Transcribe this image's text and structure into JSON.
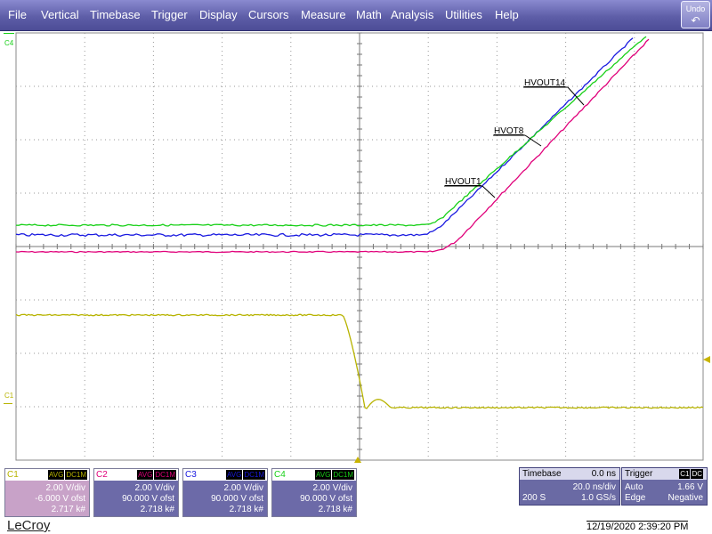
{
  "menu": {
    "items": [
      "File",
      "Vertical",
      "Timebase",
      "Trigger",
      "Display",
      "Cursors",
      "Measure",
      "Math",
      "Analysis",
      "Utilities",
      "Help"
    ],
    "undo_label": "Undo",
    "undo_icon": "undo-arrow-icon"
  },
  "markers": {
    "c4_marker": "C4",
    "c1_marker": "C1"
  },
  "trace_labels": {
    "hvout14": "HVOUT14",
    "hvot8": "HVOT8",
    "hvout1": "HVOUT1"
  },
  "channels": [
    {
      "name": "C1",
      "mode": "AVG",
      "coupling": "DC1M",
      "vdiv": "2.00 V/div",
      "offset": "-6.000 V ofst",
      "count": "2.717 k#",
      "color": "#b7b300",
      "bg": "#c8a2c8"
    },
    {
      "name": "C2",
      "mode": "AVG",
      "coupling": "DC1M",
      "vdiv": "2.00 V/div",
      "offset": "90.000 V ofst",
      "count": "2.718 k#",
      "color": "#e0007a",
      "bg": "#6c6aa8"
    },
    {
      "name": "C3",
      "mode": "AVG",
      "coupling": "DC1M",
      "vdiv": "2.00 V/div",
      "offset": "90.000 V ofst",
      "count": "2.718 k#",
      "color": "#1a1ae0",
      "bg": "#6c6aa8"
    },
    {
      "name": "C4",
      "mode": "AVG",
      "coupling": "DC1M",
      "vdiv": "2.00 V/div",
      "offset": "90.000 V ofst",
      "count": "2.718 k#",
      "color": "#18d018",
      "bg": "#6c6aa8"
    }
  ],
  "timebase": {
    "title": "Timebase",
    "delay": "0.0 ns",
    "per_div": "20.0 ns/div",
    "samples": "200 S",
    "rate": "1.0 GS/s"
  },
  "trigger": {
    "title": "Trigger",
    "source": "C1",
    "coupling": "DC",
    "mode": "Auto",
    "level": "1.66 V",
    "type": "Edge",
    "slope": "Negative"
  },
  "brand": "LeCroy",
  "datetime": "12/19/2020 2:39:20 PM",
  "colors": {
    "c1_trace": "#b7b300",
    "c2_trace": "#e0007a",
    "c3_trace": "#1a1ae0",
    "c4_trace": "#18d018",
    "menubar": "#5e5ea8"
  }
}
